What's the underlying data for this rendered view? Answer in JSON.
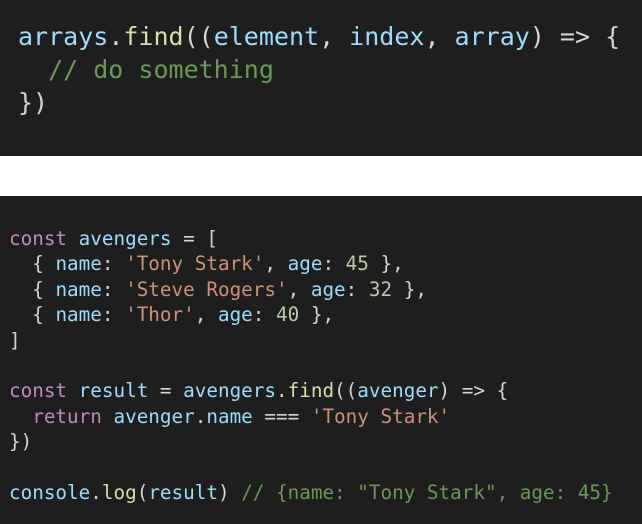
{
  "colors": {
    "background": "#1e1e1e",
    "separator": "#ffffff",
    "keyword": "#c586c0",
    "variable": "#9cdcfe",
    "function": "#dcdcaa",
    "string": "#ce9178",
    "number": "#b5cea8",
    "comment": "#6a9955",
    "punctuation": "#d4d4d4"
  },
  "snippets": [
    {
      "lines": [
        [
          {
            "t": "arrays",
            "c": "variable"
          },
          {
            "t": ".",
            "c": "punctuation"
          },
          {
            "t": "find",
            "c": "function"
          },
          {
            "t": "((",
            "c": "punctuation"
          },
          {
            "t": "element",
            "c": "variable"
          },
          {
            "t": ", ",
            "c": "punctuation"
          },
          {
            "t": "index",
            "c": "variable"
          },
          {
            "t": ", ",
            "c": "punctuation"
          },
          {
            "t": "array",
            "c": "variable"
          },
          {
            "t": ") => {",
            "c": "punctuation"
          }
        ],
        [
          {
            "t": "  // do something",
            "c": "comment"
          }
        ],
        [
          {
            "t": "})",
            "c": "punctuation"
          }
        ]
      ]
    },
    {
      "lines": [
        [
          {
            "t": "const ",
            "c": "keyword"
          },
          {
            "t": "avengers",
            "c": "variable"
          },
          {
            "t": " = [",
            "c": "punctuation"
          }
        ],
        [
          {
            "t": "  { ",
            "c": "punctuation"
          },
          {
            "t": "name",
            "c": "variable"
          },
          {
            "t": ": ",
            "c": "punctuation"
          },
          {
            "t": "'Tony Stark'",
            "c": "string"
          },
          {
            "t": ", ",
            "c": "punctuation"
          },
          {
            "t": "age",
            "c": "variable"
          },
          {
            "t": ": ",
            "c": "punctuation"
          },
          {
            "t": "45",
            "c": "number"
          },
          {
            "t": " },",
            "c": "punctuation"
          }
        ],
        [
          {
            "t": "  { ",
            "c": "punctuation"
          },
          {
            "t": "name",
            "c": "variable"
          },
          {
            "t": ": ",
            "c": "punctuation"
          },
          {
            "t": "'Steve Rogers'",
            "c": "string"
          },
          {
            "t": ", ",
            "c": "punctuation"
          },
          {
            "t": "age",
            "c": "variable"
          },
          {
            "t": ": ",
            "c": "punctuation"
          },
          {
            "t": "32",
            "c": "number"
          },
          {
            "t": " },",
            "c": "punctuation"
          }
        ],
        [
          {
            "t": "  { ",
            "c": "punctuation"
          },
          {
            "t": "name",
            "c": "variable"
          },
          {
            "t": ": ",
            "c": "punctuation"
          },
          {
            "t": "'Thor'",
            "c": "string"
          },
          {
            "t": ", ",
            "c": "punctuation"
          },
          {
            "t": "age",
            "c": "variable"
          },
          {
            "t": ": ",
            "c": "punctuation"
          },
          {
            "t": "40",
            "c": "number"
          },
          {
            "t": " },",
            "c": "punctuation"
          }
        ],
        [
          {
            "t": "]",
            "c": "punctuation"
          }
        ],
        [],
        [
          {
            "t": "const ",
            "c": "keyword"
          },
          {
            "t": "result",
            "c": "variable"
          },
          {
            "t": " = ",
            "c": "punctuation"
          },
          {
            "t": "avengers",
            "c": "variable"
          },
          {
            "t": ".",
            "c": "punctuation"
          },
          {
            "t": "find",
            "c": "function"
          },
          {
            "t": "((",
            "c": "punctuation"
          },
          {
            "t": "avenger",
            "c": "variable"
          },
          {
            "t": ") => {",
            "c": "punctuation"
          }
        ],
        [
          {
            "t": "  return ",
            "c": "keyword"
          },
          {
            "t": "avenger",
            "c": "variable"
          },
          {
            "t": ".",
            "c": "punctuation"
          },
          {
            "t": "name",
            "c": "variable"
          },
          {
            "t": " === ",
            "c": "punctuation"
          },
          {
            "t": "'Tony Stark'",
            "c": "string"
          }
        ],
        [
          {
            "t": "})",
            "c": "punctuation"
          }
        ],
        [],
        [
          {
            "t": "console",
            "c": "variable"
          },
          {
            "t": ".",
            "c": "punctuation"
          },
          {
            "t": "log",
            "c": "function"
          },
          {
            "t": "(",
            "c": "punctuation"
          },
          {
            "t": "result",
            "c": "variable"
          },
          {
            "t": ") ",
            "c": "punctuation"
          },
          {
            "t": "// {name: \"Tony Stark\", age: 45}",
            "c": "comment"
          }
        ]
      ]
    }
  ]
}
